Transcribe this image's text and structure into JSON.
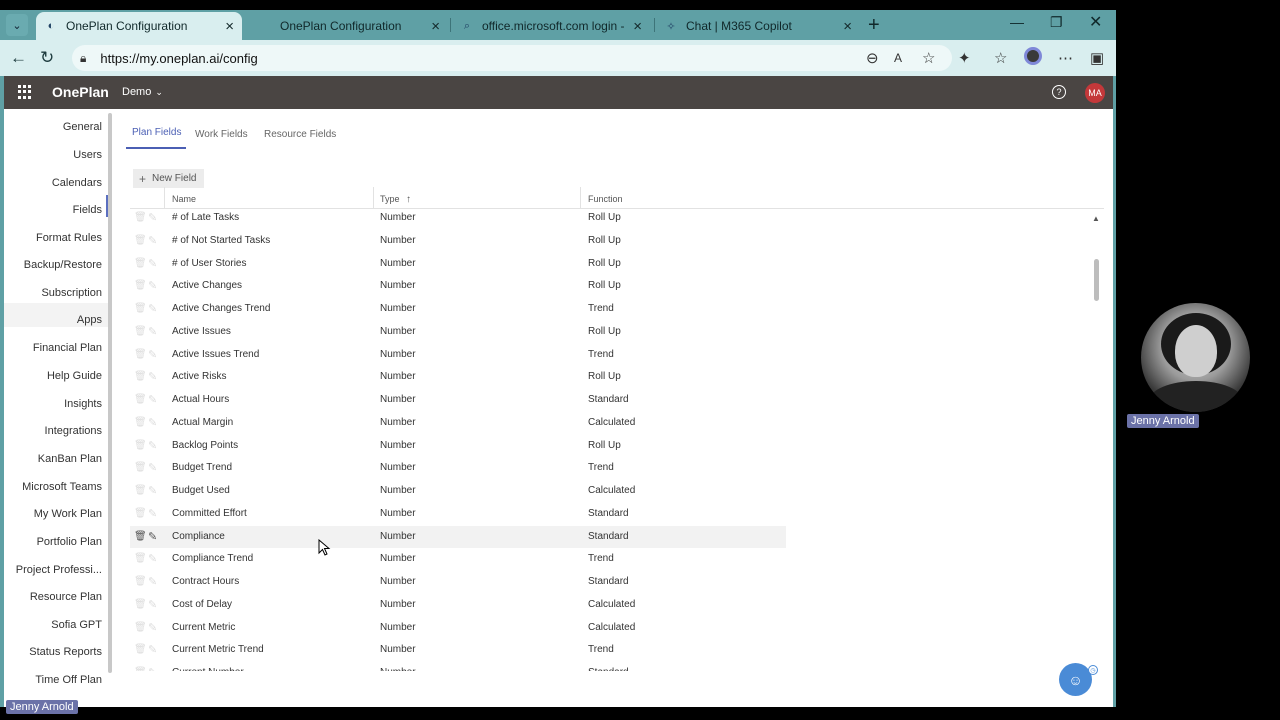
{
  "browser": {
    "tabs": [
      {
        "label": "OnePlan Configuration",
        "active": true
      },
      {
        "label": "OnePlan Configuration",
        "active": false
      },
      {
        "label": "office.microsoft.com login - Searc",
        "active": false
      },
      {
        "label": "Chat | M365 Copilot",
        "active": false
      }
    ],
    "url": "https://my.oneplan.ai/config"
  },
  "appbar": {
    "brand": "OnePlan",
    "workspace": "Demo",
    "avatar_initials": "MA",
    "help_glyph": "?"
  },
  "sidebar": {
    "items": [
      {
        "label": "General"
      },
      {
        "label": "Users"
      },
      {
        "label": "Calendars"
      },
      {
        "label": "Fields"
      },
      {
        "label": "Format Rules"
      },
      {
        "label": "Backup/Restore"
      },
      {
        "label": "Subscription"
      },
      {
        "label": "Apps"
      },
      {
        "label": "Financial Plan"
      },
      {
        "label": "Help Guide"
      },
      {
        "label": "Insights"
      },
      {
        "label": "Integrations"
      },
      {
        "label": "KanBan Plan"
      },
      {
        "label": "Microsoft Teams"
      },
      {
        "label": "My Work Plan"
      },
      {
        "label": "Portfolio Plan"
      },
      {
        "label": "Project Professi..."
      },
      {
        "label": "Resource Plan"
      },
      {
        "label": "Sofia GPT"
      },
      {
        "label": "Status Reports"
      },
      {
        "label": "Time Off Plan"
      }
    ]
  },
  "main": {
    "tabs": [
      {
        "label": "Plan Fields"
      },
      {
        "label": "Work Fields"
      },
      {
        "label": "Resource Fields"
      }
    ],
    "new_field_label": "New Field",
    "columns": {
      "name": "Name",
      "type": "Type",
      "function": "Function"
    },
    "rows": [
      {
        "name": "# of Late Tasks",
        "type": "Number",
        "function": "Roll Up"
      },
      {
        "name": "# of Not Started Tasks",
        "type": "Number",
        "function": "Roll Up"
      },
      {
        "name": "# of User Stories",
        "type": "Number",
        "function": "Roll Up"
      },
      {
        "name": "Active Changes",
        "type": "Number",
        "function": "Roll Up"
      },
      {
        "name": "Active Changes Trend",
        "type": "Number",
        "function": "Trend"
      },
      {
        "name": "Active Issues",
        "type": "Number",
        "function": "Roll Up"
      },
      {
        "name": "Active Issues Trend",
        "type": "Number",
        "function": "Trend"
      },
      {
        "name": "Active Risks",
        "type": "Number",
        "function": "Roll Up"
      },
      {
        "name": "Actual Hours",
        "type": "Number",
        "function": "Standard"
      },
      {
        "name": "Actual Margin",
        "type": "Number",
        "function": "Calculated"
      },
      {
        "name": "Backlog Points",
        "type": "Number",
        "function": "Roll Up"
      },
      {
        "name": "Budget Trend",
        "type": "Number",
        "function": "Trend"
      },
      {
        "name": "Budget Used",
        "type": "Number",
        "function": "Calculated"
      },
      {
        "name": "Committed Effort",
        "type": "Number",
        "function": "Standard"
      },
      {
        "name": "Compliance",
        "type": "Number",
        "function": "Standard"
      },
      {
        "name": "Compliance Trend",
        "type": "Number",
        "function": "Trend"
      },
      {
        "name": "Contract Hours",
        "type": "Number",
        "function": "Standard"
      },
      {
        "name": "Cost of Delay",
        "type": "Number",
        "function": "Calculated"
      },
      {
        "name": "Current Metric",
        "type": "Number",
        "function": "Calculated"
      },
      {
        "name": "Current Metric Trend",
        "type": "Number",
        "function": "Trend"
      },
      {
        "name": "Current Number",
        "type": "Number",
        "function": "Standard"
      }
    ]
  },
  "participants": {
    "webcam_name": "Jenny Arnold",
    "presenter_name": "Jenny Arnold"
  },
  "colors": {
    "browser_chrome": "#5fa0a5",
    "appbar": "#4a4543",
    "accent": "#4b5fb4",
    "avatar": "#c4383a"
  }
}
